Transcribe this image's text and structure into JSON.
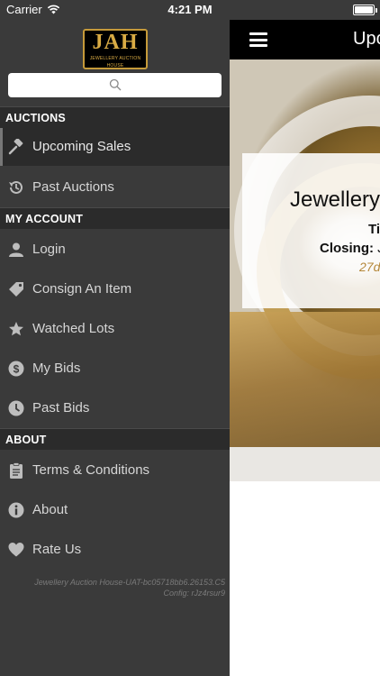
{
  "status_bar": {
    "carrier": "Carrier",
    "time": "4:21 PM"
  },
  "main": {
    "title": "Upco",
    "card": {
      "title": "Jewellery",
      "line2": "Ti",
      "closing_label": "Closing:",
      "closing_value": "Ju",
      "countdown": "27d"
    }
  },
  "drawer": {
    "logo": {
      "main": "JAH",
      "sub": "JEWELLERY AUCTION HOUSE"
    },
    "search": {
      "placeholder": ""
    },
    "sections": [
      {
        "label": "AUCTIONS",
        "items": [
          {
            "label": "Upcoming Sales",
            "icon": "gavel-icon"
          },
          {
            "label": "Past Auctions",
            "icon": "history-icon"
          }
        ]
      },
      {
        "label": "MY ACCOUNT",
        "items": [
          {
            "label": "Login",
            "icon": "user-icon"
          },
          {
            "label": "Consign An Item",
            "icon": "tag-icon"
          },
          {
            "label": "Watched Lots",
            "icon": "star-icon"
          },
          {
            "label": "My Bids",
            "icon": "dollar-icon"
          },
          {
            "label": "Past Bids",
            "icon": "clock-icon"
          }
        ]
      },
      {
        "label": "ABOUT",
        "items": [
          {
            "label": "Terms & Conditions",
            "icon": "clipboard-icon"
          },
          {
            "label": "About",
            "icon": "info-icon"
          },
          {
            "label": "Rate Us",
            "icon": "heart-icon"
          }
        ]
      }
    ],
    "footer": {
      "line1": "Jewellery Auction House-UAT-bc05718bb6.26153.C5",
      "line2": "Config: rJz4rsur9"
    }
  },
  "colors": {
    "accent_gold": "#c59a3a",
    "drawer_bg": "#3a3a3a",
    "section_bg": "#2b2b2b"
  }
}
